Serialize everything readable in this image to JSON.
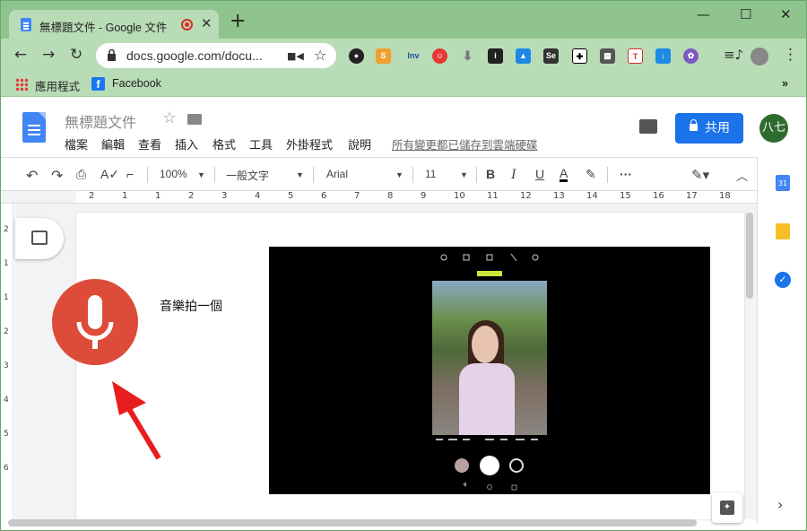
{
  "browser": {
    "tab_title": "無標題文件 - Google 文件",
    "new_tab": "+",
    "win_min": "—",
    "win_max": "☐",
    "win_close": "✕",
    "url": "docs.google.com/docu...",
    "extensions": [
      "Inv"
    ],
    "bookmarks": {
      "apps": "應用程式",
      "facebook": "Facebook",
      "more": "»"
    }
  },
  "docs": {
    "title": "無標題文件",
    "menu": [
      "檔案",
      "編輯",
      "查看",
      "插入",
      "格式",
      "工具",
      "外掛程式",
      "說明"
    ],
    "saved_status": "所有變更都已儲存到雲端硬碟",
    "share_label": "共用",
    "user_avatar": "八七"
  },
  "toolbar": {
    "zoom": "100%",
    "style": "一般文字",
    "font": "Arial",
    "size": "11"
  },
  "ruler": {
    "top_ticks": [
      "2",
      "1",
      "1",
      "2",
      "3",
      "4",
      "5",
      "6",
      "7",
      "8",
      "9",
      "10",
      "11",
      "12",
      "13",
      "14",
      "15",
      "16",
      "17",
      "18"
    ],
    "left_ticks": [
      "2",
      "1",
      "1",
      "2",
      "3",
      "4",
      "5",
      "6"
    ]
  },
  "document": {
    "text": "音樂拍一個"
  },
  "colors": {
    "accent": "#1a73e8",
    "mic": "#dd4b39",
    "chrome": "#8fc48f"
  }
}
